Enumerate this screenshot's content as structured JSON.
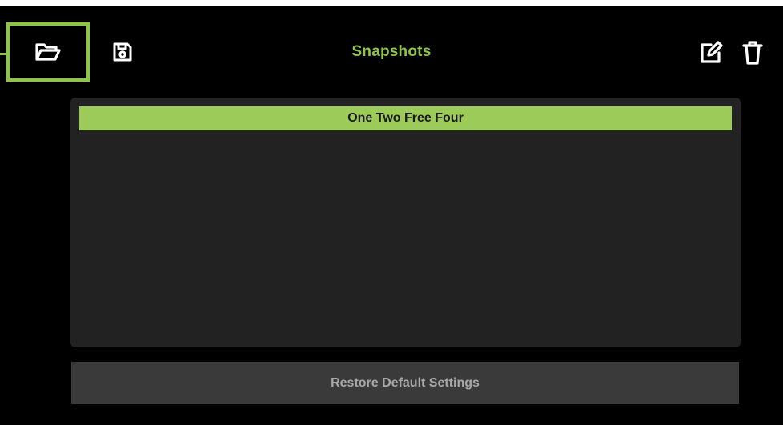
{
  "header": {
    "title": "Snapshots",
    "icons": {
      "open": "folder-open-icon",
      "save": "floppy-disk-icon",
      "edit": "edit-pencil-icon",
      "delete": "trash-icon"
    }
  },
  "snapshots": {
    "items": [
      {
        "label": "One Two Free Four",
        "selected": true
      }
    ]
  },
  "footer": {
    "restore_label": "Restore Default Settings"
  },
  "colors": {
    "accent": "#8fc44b",
    "selected_row": "#9ccb5a",
    "background": "#000000",
    "panel": "#222222",
    "button": "#3a3a3a"
  }
}
